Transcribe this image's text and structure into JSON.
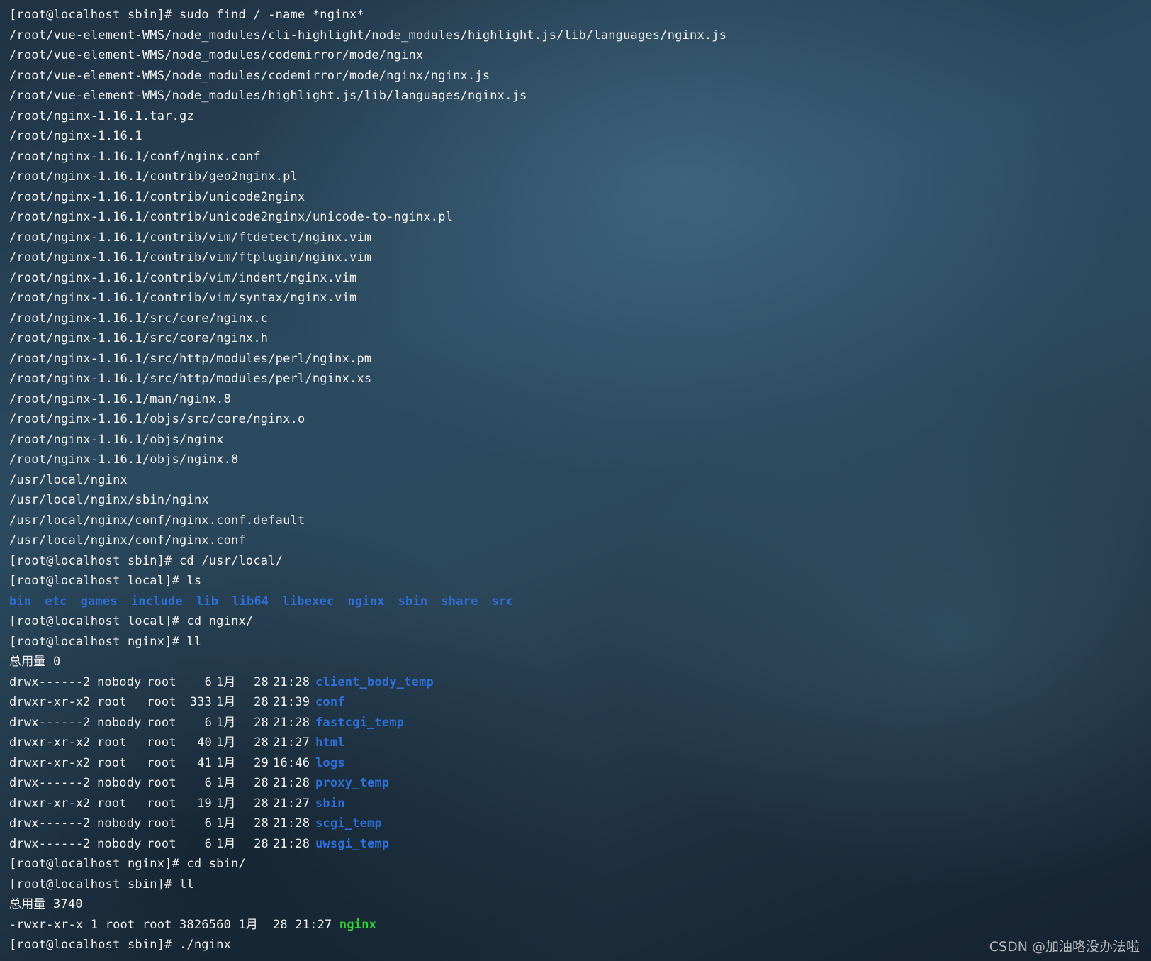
{
  "terminal": {
    "lines": [
      "[root@localhost sbin]# sudo find / -name *nginx*",
      "/root/vue-element-WMS/node_modules/cli-highlight/node_modules/highlight.js/lib/languages/nginx.js",
      "/root/vue-element-WMS/node_modules/codemirror/mode/nginx",
      "/root/vue-element-WMS/node_modules/codemirror/mode/nginx/nginx.js",
      "/root/vue-element-WMS/node_modules/highlight.js/lib/languages/nginx.js",
      "/root/nginx-1.16.1.tar.gz",
      "/root/nginx-1.16.1",
      "/root/nginx-1.16.1/conf/nginx.conf",
      "/root/nginx-1.16.1/contrib/geo2nginx.pl",
      "/root/nginx-1.16.1/contrib/unicode2nginx",
      "/root/nginx-1.16.1/contrib/unicode2nginx/unicode-to-nginx.pl",
      "/root/nginx-1.16.1/contrib/vim/ftdetect/nginx.vim",
      "/root/nginx-1.16.1/contrib/vim/ftplugin/nginx.vim",
      "/root/nginx-1.16.1/contrib/vim/indent/nginx.vim",
      "/root/nginx-1.16.1/contrib/vim/syntax/nginx.vim",
      "/root/nginx-1.16.1/src/core/nginx.c",
      "/root/nginx-1.16.1/src/core/nginx.h",
      "/root/nginx-1.16.1/src/http/modules/perl/nginx.pm",
      "/root/nginx-1.16.1/src/http/modules/perl/nginx.xs",
      "/root/nginx-1.16.1/man/nginx.8",
      "/root/nginx-1.16.1/objs/src/core/nginx.o",
      "/root/nginx-1.16.1/objs/nginx",
      "/root/nginx-1.16.1/objs/nginx.8",
      "/usr/local/nginx",
      "/usr/local/nginx/sbin/nginx",
      "/usr/local/nginx/conf/nginx.conf.default",
      "/usr/local/nginx/conf/nginx.conf",
      "[root@localhost sbin]# cd /usr/local/",
      "[root@localhost local]# ls"
    ],
    "ls_entries": [
      "bin",
      "etc",
      "games",
      "include",
      "lib",
      "lib64",
      "libexec",
      "nginx",
      "sbin",
      "share",
      "src"
    ],
    "cmd_cd_nginx": "[root@localhost local]# cd nginx/",
    "cmd_ll_1": "[root@localhost nginx]# ll",
    "total_1": "总用量 0",
    "listing_1": [
      {
        "perm": "drwx------",
        "links": "2",
        "owner": "nobody",
        "group": "root",
        "size": "6",
        "month": "1月",
        "day": "28",
        "time": "21:28",
        "name": "client_body_temp"
      },
      {
        "perm": "drwxr-xr-x",
        "links": "2",
        "owner": "root",
        "group": "root",
        "size": "333",
        "month": "1月",
        "day": "28",
        "time": "21:39",
        "name": "conf"
      },
      {
        "perm": "drwx------",
        "links": "2",
        "owner": "nobody",
        "group": "root",
        "size": "6",
        "month": "1月",
        "day": "28",
        "time": "21:28",
        "name": "fastcgi_temp"
      },
      {
        "perm": "drwxr-xr-x",
        "links": "2",
        "owner": "root",
        "group": "root",
        "size": "40",
        "month": "1月",
        "day": "28",
        "time": "21:27",
        "name": "html"
      },
      {
        "perm": "drwxr-xr-x",
        "links": "2",
        "owner": "root",
        "group": "root",
        "size": "41",
        "month": "1月",
        "day": "29",
        "time": "16:46",
        "name": "logs"
      },
      {
        "perm": "drwx------",
        "links": "2",
        "owner": "nobody",
        "group": "root",
        "size": "6",
        "month": "1月",
        "day": "28",
        "time": "21:28",
        "name": "proxy_temp"
      },
      {
        "perm": "drwxr-xr-x",
        "links": "2",
        "owner": "root",
        "group": "root",
        "size": "19",
        "month": "1月",
        "day": "28",
        "time": "21:27",
        "name": "sbin"
      },
      {
        "perm": "drwx------",
        "links": "2",
        "owner": "nobody",
        "group": "root",
        "size": "6",
        "month": "1月",
        "day": "28",
        "time": "21:28",
        "name": "scgi_temp"
      },
      {
        "perm": "drwx------",
        "links": "2",
        "owner": "nobody",
        "group": "root",
        "size": "6",
        "month": "1月",
        "day": "28",
        "time": "21:28",
        "name": "uwsgi_temp"
      }
    ],
    "cmd_cd_sbin": "[root@localhost nginx]# cd sbin/",
    "cmd_ll_2": "[root@localhost sbin]# ll",
    "total_2": "总用量 3740",
    "listing_2_prefix": "-rwxr-xr-x 1 root root 3826560 1月  28 21:27 ",
    "listing_2_name": "nginx",
    "cmd_run": "[root@localhost sbin]# ./nginx"
  },
  "colors": {
    "directory": "#2f6fd8",
    "executable": "#2ed62e",
    "text": "#f2f2f2"
  },
  "watermark": "CSDN @加油咯没办法啦"
}
